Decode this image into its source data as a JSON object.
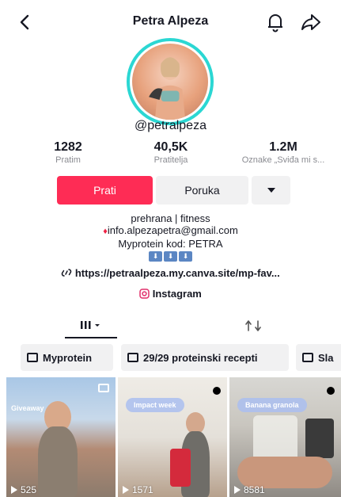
{
  "header": {
    "title": "Petra Alpeza"
  },
  "profile": {
    "handle": "@petralpeza"
  },
  "stats": [
    {
      "value": "1282",
      "label": "Pratim"
    },
    {
      "value": "40,5K",
      "label": "Pratitelja"
    },
    {
      "value": "1.2M",
      "label": "Oznake „Sviđa mi s..."
    }
  ],
  "actions": {
    "follow": "Prati",
    "message": "Poruka"
  },
  "bio": {
    "line1": "prehrana | fitness",
    "line2": "info.alpezapetra@gmail.com",
    "line3": "Myprotein kod: PETRA",
    "emojis": [
      "⬇",
      "⬇",
      "⬇"
    ]
  },
  "link": {
    "url": "https://petraalpeza.my.canva.site/mp-fav..."
  },
  "instagram": {
    "label": "Instagram"
  },
  "tabs": {
    "grid_icon": "grid-icon",
    "repost_icon": "repost-icon"
  },
  "playlists": [
    {
      "label": "Myprotein"
    },
    {
      "label": "29/29 proteinski recepti"
    },
    {
      "label": "Sla"
    }
  ],
  "videos": [
    {
      "overlay": "Giveaway",
      "views": "525"
    },
    {
      "overlay": "Impact week",
      "views": "1571"
    },
    {
      "overlay": "Banana granola",
      "views": "8581"
    }
  ],
  "colors": {
    "accent": "#fe2c55",
    "ring": "#2bd7d3"
  }
}
